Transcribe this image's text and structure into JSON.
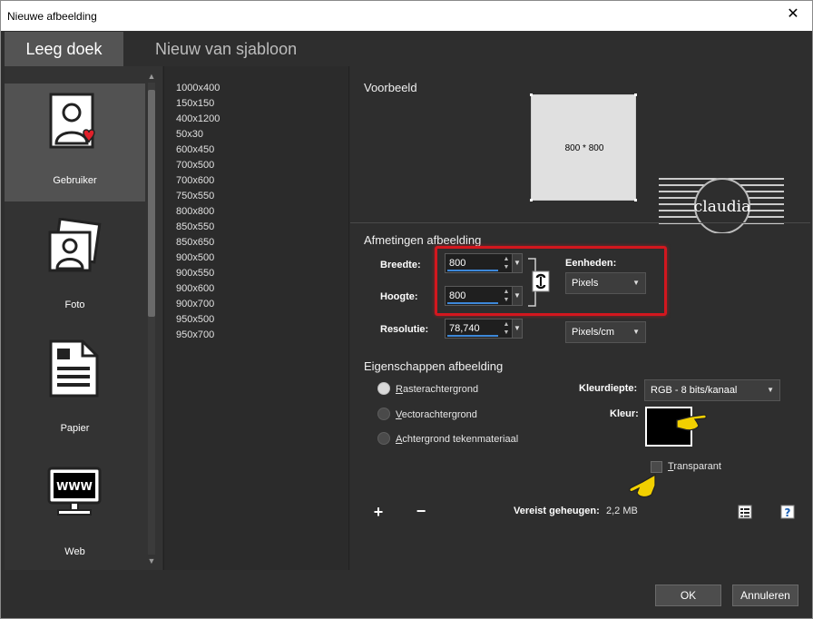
{
  "window": {
    "title": "Nieuwe afbeelding"
  },
  "tabs": [
    {
      "label": "Leeg doek"
    },
    {
      "label": "Nieuw van sjabloon"
    }
  ],
  "categories": [
    {
      "label": "Gebruiker"
    },
    {
      "label": "Foto"
    },
    {
      "label": "Papier"
    },
    {
      "label": "Web"
    }
  ],
  "presets": [
    "1000x400",
    "150x150",
    "400x1200",
    "50x30",
    "600x450",
    "700x500",
    "700x600",
    "750x550",
    "800x800",
    "850x550",
    "850x650",
    "900x500",
    "900x550",
    "900x600",
    "900x700",
    "950x500",
    "950x700"
  ],
  "preview": {
    "title": "Voorbeeld",
    "dimensions": "800 * 800"
  },
  "watermark": {
    "text": "claudia"
  },
  "dimensions": {
    "title": "Afmetingen afbeelding",
    "width_label": "Breedte:",
    "width_value": "800",
    "height_label": "Hoogte:",
    "height_value": "800",
    "units_label": "Eenheden:",
    "units_value": "Pixels",
    "resolution_label": "Resolutie:",
    "resolution_value": "78,740",
    "resolution_unit": "Pixels/cm"
  },
  "properties": {
    "title": "Eigenschappen afbeelding",
    "raster_label_u": "R",
    "raster_label_rest": "asterachtergrond",
    "vector_label_u": "V",
    "vector_label_rest": "ectorachtergrond",
    "art_label_u": "A",
    "art_label_rest": "chtergrond tekenmateriaal",
    "depth_label": "Kleurdiepte:",
    "depth_value": "RGB - 8 bits/kanaal",
    "color_label": "Kleur:",
    "color_value": "#000000",
    "transparent_label_u": "T",
    "transparent_label_rest": "ransparant"
  },
  "memory": {
    "label": "Vereist geheugen:",
    "value": "2,2 MB"
  },
  "buttons": {
    "ok": "OK",
    "cancel": "Annuleren"
  },
  "colors": {
    "highlight": "#d3171e",
    "accent": "#3d88d9"
  }
}
